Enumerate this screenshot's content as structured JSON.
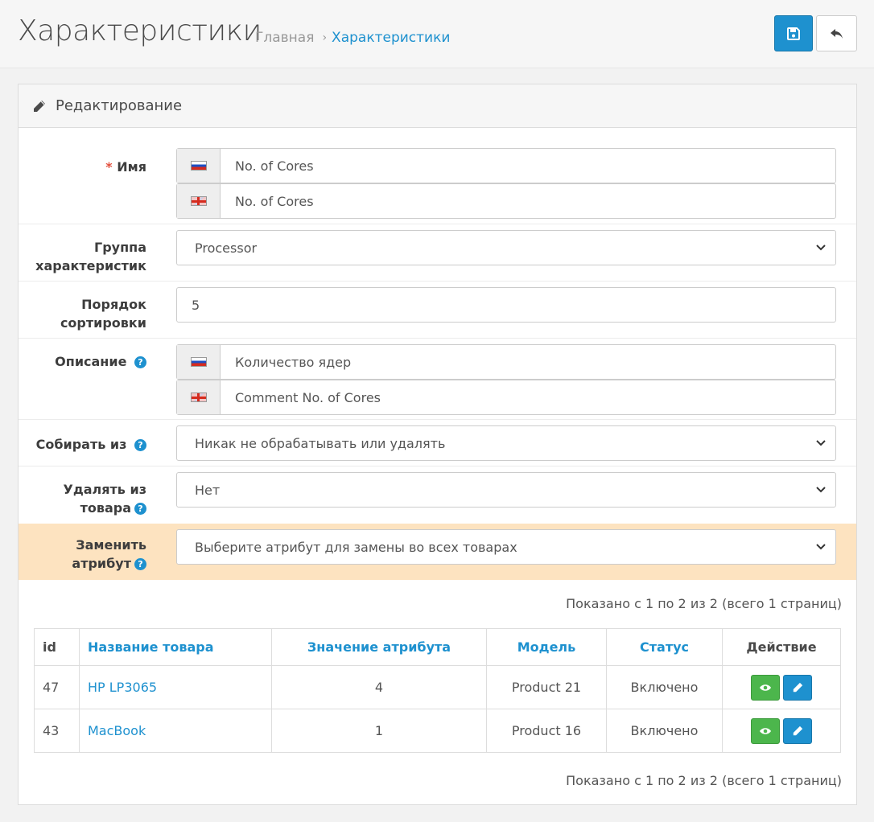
{
  "header": {
    "title": "Характеристики",
    "breadcrumb": {
      "home": "Главная",
      "sep": "›",
      "current": "Характеристики"
    }
  },
  "panel": {
    "title": "Редактирование",
    "name": {
      "label": "Имя",
      "required_mark": "*",
      "ru_value": "No. of Cores",
      "en_value": "No. of Cores"
    },
    "group": {
      "label_1": "Группа",
      "label_2": "характеристик",
      "selected": "Processor"
    },
    "sort": {
      "label_1": "Порядок",
      "label_2": "сортировки",
      "value": "5"
    },
    "description": {
      "label": "Описание",
      "ru_value": "Количество ядер",
      "en_value": "Comment No. of Cores"
    },
    "collect": {
      "label": "Собирать из",
      "selected": "Никак не обрабатывать или удалять"
    },
    "remove": {
      "label_1": "Удалять из",
      "label_2": "товара",
      "selected": "Нет"
    },
    "replace": {
      "label_1": "Заменить",
      "label_2": "атрибут",
      "selected": "Выберите атрибут для замены во всех товарах"
    },
    "help_glyph": "?",
    "pagination_text": "Показано с 1 по 2 из 2 (всего 1 страниц)",
    "table": {
      "headers": {
        "id": "id",
        "name": "Название товара",
        "value": "Значение атрибута",
        "model": "Модель",
        "status": "Статус",
        "action": "Действие"
      },
      "rows": [
        {
          "id": "47",
          "name": "HP LP3065",
          "value": "4",
          "model": "Product 21",
          "status": "Включено"
        },
        {
          "id": "43",
          "name": "MacBook",
          "value": "1",
          "model": "Product 16",
          "status": "Включено"
        }
      ]
    }
  },
  "colors": {
    "primary": "#1e91cf",
    "success": "#4cb64c",
    "highlight_row": "#fde3c0",
    "required": "#e3503e"
  },
  "icons": {
    "save": "floppy-icon",
    "back": "reply-icon",
    "heading": "pencil-icon",
    "view": "eye-icon",
    "edit": "pencil-icon",
    "select": "chevron-down-icon"
  }
}
